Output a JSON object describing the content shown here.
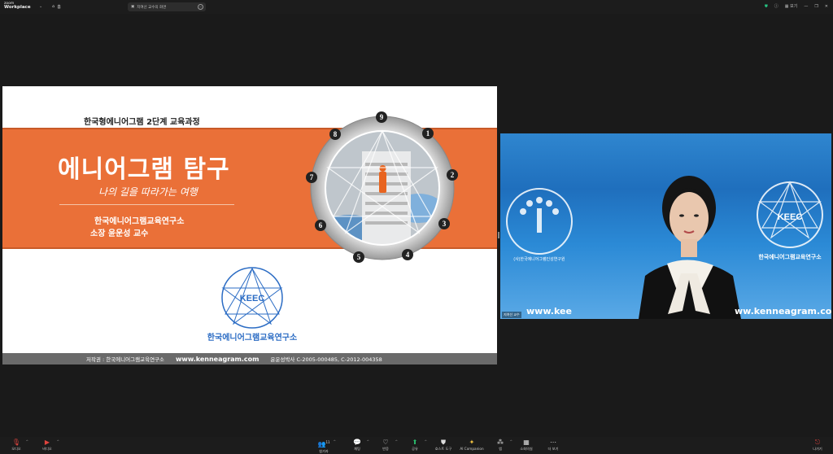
{
  "app": {
    "logo_line1": "zoom",
    "logo_line2": "Workplace",
    "home_label": "홈",
    "meeting_title": "지여선 교수의 화면",
    "view_label": "보기"
  },
  "slide": {
    "top_title": "한국형에니어그램 2단계 교육과정",
    "main_title": "에니어그램 탐구",
    "subtitle": "나의 길을 따라가는 여행",
    "institute": "한국에니어그램교육연구소",
    "presenter": "소장 윤운성 교수",
    "enneagram_numbers": [
      "1",
      "2",
      "3",
      "4",
      "5",
      "6",
      "7",
      "8",
      "9"
    ],
    "logo_text": "KEEC",
    "logo_ring_text": "한국에니어그램교육연구소",
    "footer_copyright": "저작권 : 한국에니어그램교육연구소",
    "footer_url": "www.kenneagram.com",
    "footer_patent": "윤운성박사 C-2005-000485, C-2012-004358"
  },
  "video": {
    "url_left": "www.kee",
    "url_right": "ww.kenneagram.com",
    "logo_right_text": "KEEC",
    "ring_text_left": "(사)한국에니어그램인성연구원",
    "ring_text_right": "한국에니어그램교육연구소",
    "name_tag": "지여선 교수"
  },
  "toolbar": {
    "audio": "오디오",
    "video": "비디오",
    "participants": "참가자",
    "participants_count": "11",
    "chat": "채팅",
    "react": "반응",
    "share": "공유",
    "host_tools": "호스트 도구",
    "ai_companion": "AI Companion",
    "apps": "앱",
    "breakout": "소회의실",
    "more": "더 보기",
    "leave": "나가기"
  },
  "colors": {
    "slide_orange": "#ea7038",
    "video_blue": "#2b8ad6",
    "leave_red": "#d63b33",
    "share_green": "#29c06e"
  }
}
